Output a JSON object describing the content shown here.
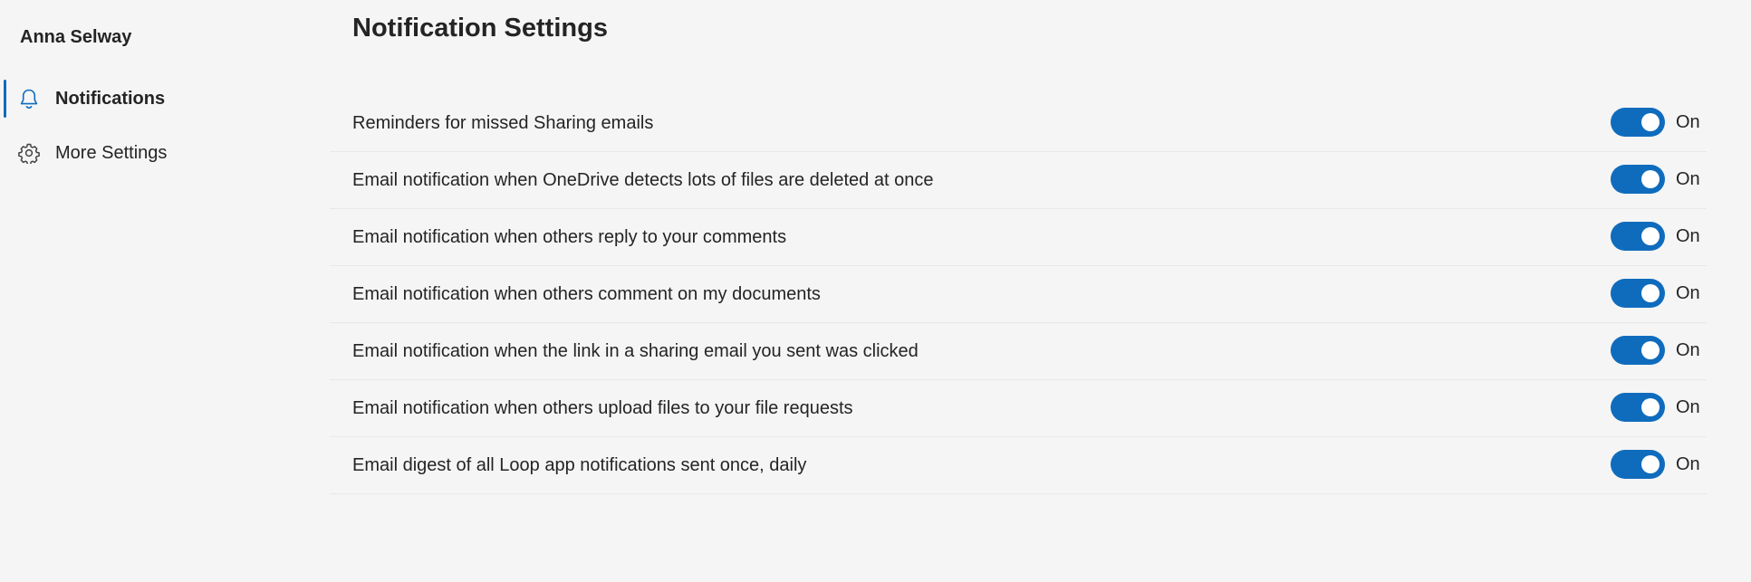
{
  "sidebar": {
    "user_name": "Anna Selway",
    "items": [
      {
        "label": "Notifications",
        "icon": "bell-icon",
        "active": true
      },
      {
        "label": "More Settings",
        "icon": "gear-icon",
        "active": false
      }
    ]
  },
  "main": {
    "title": "Notification Settings",
    "settings": [
      {
        "label": "Reminders for missed Sharing emails",
        "state": "On"
      },
      {
        "label": "Email notification when OneDrive detects lots of files are deleted at once",
        "state": "On"
      },
      {
        "label": "Email notification when others reply to your comments",
        "state": "On"
      },
      {
        "label": "Email notification when others comment on my documents",
        "state": "On"
      },
      {
        "label": "Email notification when the link in a sharing email you sent was clicked",
        "state": "On"
      },
      {
        "label": "Email notification when others upload files to your file requests",
        "state": "On"
      },
      {
        "label": "Email digest of all Loop app notifications sent once, daily",
        "state": "On"
      }
    ]
  },
  "colors": {
    "accent": "#0f6cbd",
    "background": "#f5f5f5",
    "text": "#242424"
  }
}
